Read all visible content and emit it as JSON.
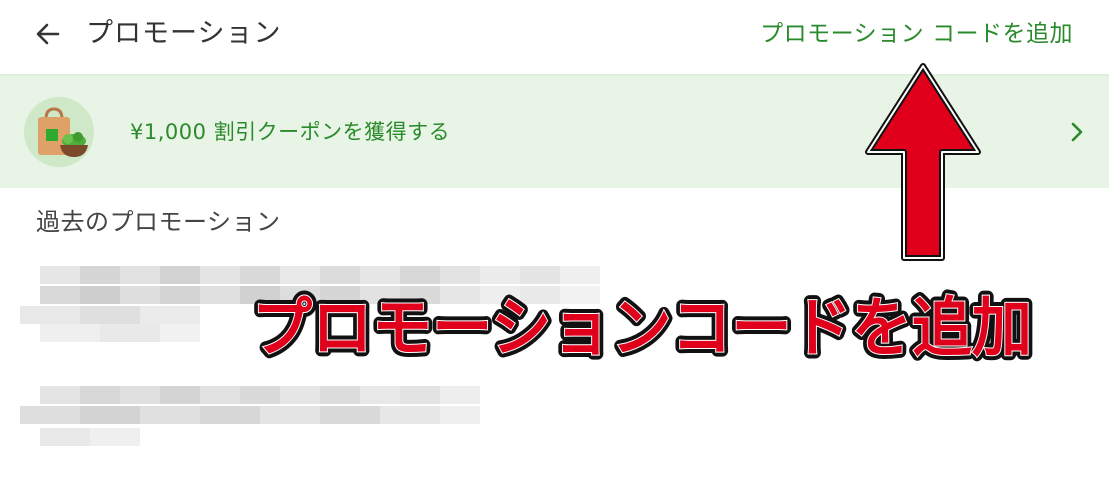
{
  "header": {
    "back_icon": "arrow-left-icon",
    "title": "プロモーション",
    "add_code_label": "プロモーション コードを追加"
  },
  "banner": {
    "illustration": "shopping-bag-salad-icon",
    "text": "¥1,000 割引クーポンを獲得する",
    "chevron_icon": "chevron-right-icon"
  },
  "past": {
    "title": "過去のプロモーション"
  },
  "annotation": {
    "label": "プロモーションコードを追加",
    "arrow_icon": "arrow-up-icon",
    "color": "#e0001b"
  },
  "colors": {
    "accent": "#2b8a2b",
    "banner_bg": "#e8f4e6"
  }
}
